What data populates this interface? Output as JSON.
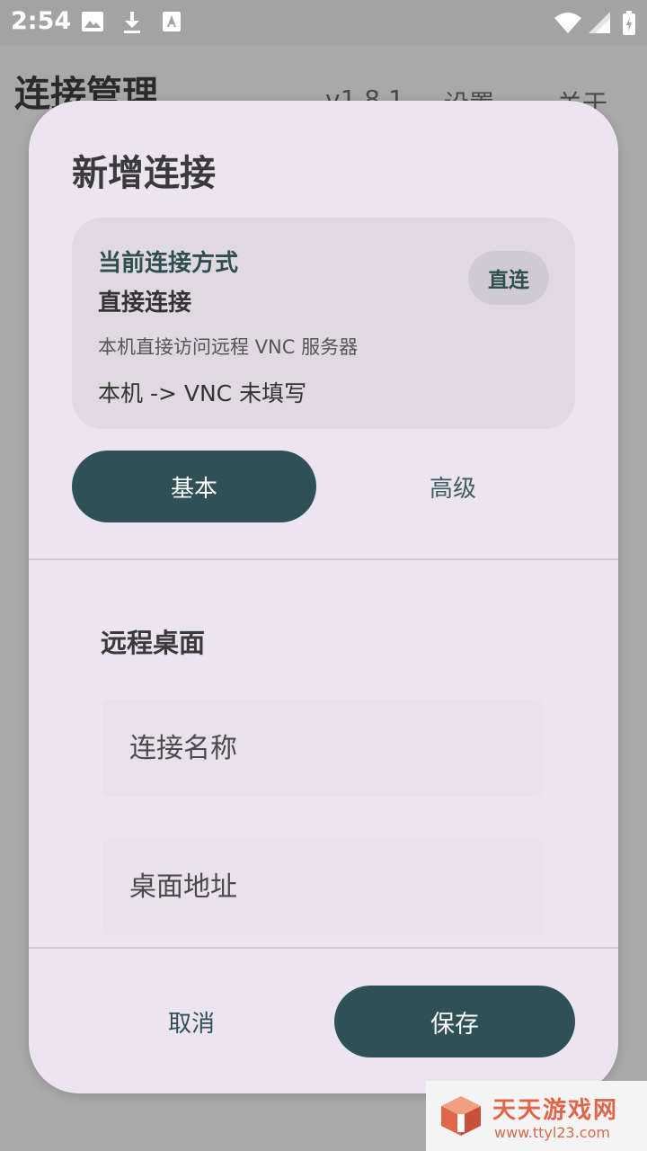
{
  "status_bar": {
    "time": "2:54",
    "icons": [
      "image-icon",
      "download-icon",
      "font-icon",
      "wifi-icon",
      "signal-icon",
      "battery-icon"
    ]
  },
  "app_bar": {
    "title": "连接管理",
    "version": "v1.8.1",
    "settings": "设置",
    "about": "关于"
  },
  "dialog": {
    "title": "新增连接",
    "mode_card": {
      "heading": "当前连接方式",
      "mode_name": "直接连接",
      "description": "本机直接访问远程 VNC 服务器",
      "route": "本机 -> VNC 未填写",
      "chip_label": "直连"
    },
    "tabs": [
      {
        "label": "基本",
        "selected": true
      },
      {
        "label": "高级",
        "selected": false
      }
    ],
    "section_title": "远程桌面",
    "fields": {
      "name_placeholder": "连接名称",
      "address_placeholder": "桌面地址"
    },
    "buttons": {
      "cancel": "取消",
      "save": "保存"
    }
  },
  "watermark": {
    "name": "天天游戏网",
    "url": "www.ttyl23.com"
  },
  "colors": {
    "accent": "#2f5056",
    "dialog_bg": "#ece4f0",
    "card_bg": "#e0d9e2",
    "scrim": "#a9a9a9"
  }
}
